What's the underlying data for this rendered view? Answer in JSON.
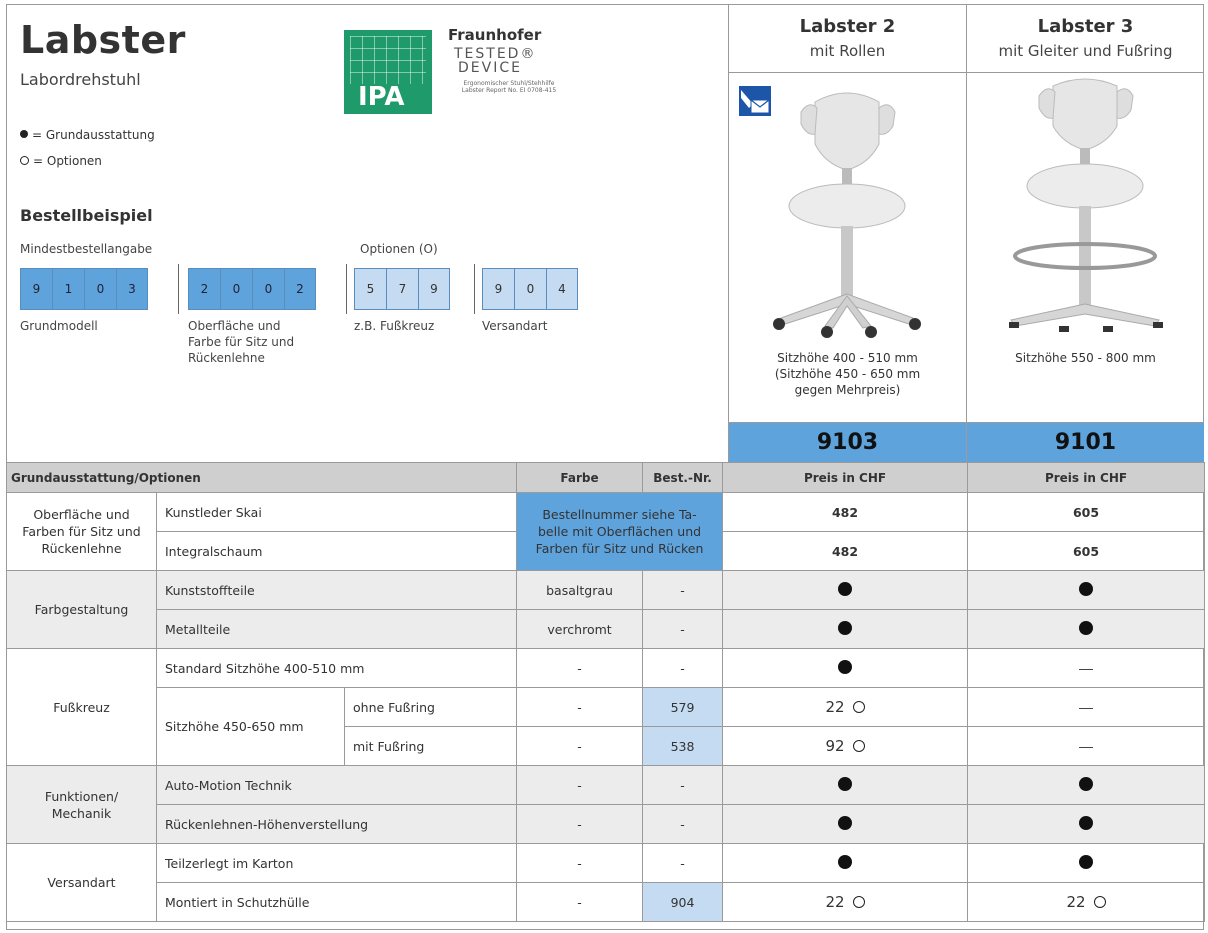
{
  "header": {
    "title": "Labster",
    "subtitle": "Labordrehstuhl",
    "legend_basic": "= Grundausstattung",
    "legend_options": "= Optionen"
  },
  "logo": {
    "ipa": "IPA",
    "fraunhofer": "Fraunhofer",
    "tested": "TESTED®",
    "device": "DEVICE",
    "small_text": "Ergonomischer Stuhl/Stehhilfe Labster Report No. EI 0708-415"
  },
  "order": {
    "title": "Bestellbeispiel",
    "min_label": "Mindestbestellangabe",
    "options_label": "Optionen (O)",
    "grundmodell": [
      "9",
      "1",
      "0",
      "3"
    ],
    "oberflaeche": [
      "2",
      "0",
      "0",
      "2"
    ],
    "option": [
      "5",
      "7",
      "9"
    ],
    "versand": [
      "9",
      "0",
      "4"
    ],
    "cap_grundmodell": "Grundmodell",
    "cap_oberflaeche_1": "Oberfläche und",
    "cap_oberflaeche_2": "Farbe für Sitz und",
    "cap_oberflaeche_3": "Rückenlehne",
    "cap_option": "z.B. Fußkreuz",
    "cap_versand": "Versandart"
  },
  "products": [
    {
      "name": "Labster 2",
      "sub": "mit Rollen",
      "caption_1": "Sitzhöhe 400 - 510 mm",
      "caption_2": "(Sitzhöhe 450 - 650 mm",
      "caption_3": "gegen Mehrpreis)",
      "code": "9103"
    },
    {
      "name": "Labster 3",
      "sub": "mit Gleiter und Fußring",
      "caption_1": "Sitzhöhe 550 - 800 mm",
      "code": "9101"
    }
  ],
  "table": {
    "head": {
      "group": "Grundausstattung/Optionen",
      "farbe": "Farbe",
      "bestnr": "Best.-Nr.",
      "price1": "Preis in CHF",
      "price2": "Preis in CHF"
    },
    "oberflaeche": {
      "group_1": "Oberfläche und",
      "group_2": "Farben für Sitz und",
      "group_3": "Rückenlehne",
      "row1": "Kunstleder Skai",
      "row2": "Integralschaum",
      "note_1": "Bestellnummer siehe Ta-",
      "note_2": "belle mit Oberflächen und",
      "note_3": "Farben für Sitz und Rücken",
      "p1_row1": "482",
      "p2_row1": "605",
      "p1_row2": "482",
      "p2_row2": "605"
    },
    "farbgestaltung": {
      "group": "Farbgestaltung",
      "row1": "Kunststoffteile",
      "row1_farbe": "basaltgrau",
      "row1_nr": "-",
      "row2": "Metallteile",
      "row2_farbe": "verchromt",
      "row2_nr": "-"
    },
    "fusskreuz": {
      "group": "Fußkreuz",
      "row1": "Standard Sitzhöhe 400-510 mm",
      "row1_farbe": "-",
      "row1_nr": "-",
      "row2": "Sitzhöhe 450-650 mm",
      "sub1": "ohne Fußring",
      "sub1_farbe": "-",
      "sub1_nr": "579",
      "sub1_p1": "22",
      "sub2": "mit Fußring",
      "sub2_farbe": "-",
      "sub2_nr": "538",
      "sub2_p1": "92"
    },
    "funktionen": {
      "group_1": "Funktionen/",
      "group_2": "Mechanik",
      "row1": "Auto-Motion Technik",
      "row1_farbe": "-",
      "row1_nr": "-",
      "row2": "Rückenlehnen-Höhenverstellung",
      "row2_farbe": "-",
      "row2_nr": "-"
    },
    "versandart": {
      "group": "Versandart",
      "row1": "Teilzerlegt im Karton",
      "row1_farbe": "-",
      "row1_nr": "-",
      "row2": "Montiert in Schutzhülle",
      "row2_farbe": "-",
      "row2_nr": "904",
      "row2_p1": "22",
      "row2_p2": "22"
    }
  },
  "colors": {
    "accent_blue": "#5fa3dd",
    "light_blue": "#c4dbf1",
    "header_gray": "#cfcfcf",
    "row_gray": "#ececec",
    "logo_green": "#1f9a6b"
  },
  "icons": [
    "shipping-envelope-icon",
    "filled-dot-icon",
    "open-circle-icon",
    "dash-icon"
  ]
}
